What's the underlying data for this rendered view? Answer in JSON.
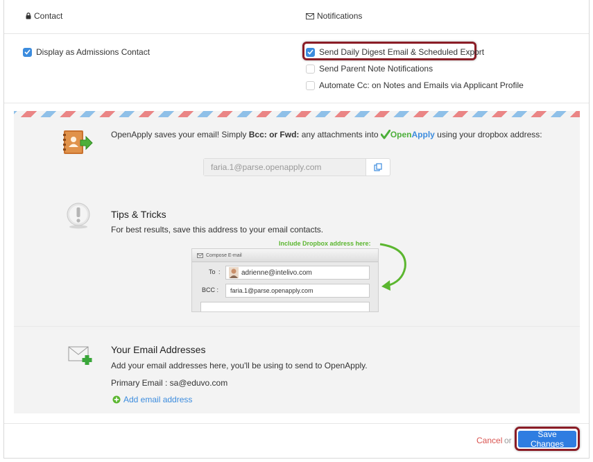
{
  "header": {
    "contact_label": "Contact",
    "notifications_label": "Notifications"
  },
  "contact": {
    "display_admissions": {
      "label": "Display as Admissions Contact",
      "checked": true
    }
  },
  "notifications": {
    "items": [
      {
        "label": "Send Daily Digest Email & Scheduled Export",
        "checked": true
      },
      {
        "label": "Send Parent Note Notifications",
        "checked": false
      },
      {
        "label": "Automate Cc: on Notes and Emails via Applicant Profile",
        "checked": false
      }
    ]
  },
  "dropbox": {
    "intro_prefix": "OpenApply saves your email! Simply ",
    "intro_bold": "Bcc: or Fwd:",
    "intro_mid": " any attachments into ",
    "brand_open": "Open",
    "brand_apply": "Apply",
    "intro_suffix": " using your dropbox address:",
    "address": "faria.1@parse.openapply.com"
  },
  "tips": {
    "title": "Tips & Tricks",
    "text": "For best results, save this address to your email contacts.",
    "illustration": {
      "note": "Include Dropbox address here:",
      "window_title": "Compose E-mail",
      "to_label": "To",
      "to_value": "adrienne@intelivo.com",
      "bcc_label": "BCC :",
      "bcc_value": "faria.1@parse.openapply.com"
    }
  },
  "email_addresses": {
    "title": "Your Email Addresses",
    "text": "Add your email addresses here, you'll be using to send to OpenApply.",
    "primary": "Primary Email : sa@eduvo.com",
    "add_link": "Add email address"
  },
  "footer": {
    "cancel": "Cancel",
    "or": "or",
    "save": "Save Changes"
  },
  "colors": {
    "accent": "#3c8cde",
    "highlight": "#8a1c25",
    "cancel": "#d9534f",
    "green": "#5bb62f"
  }
}
